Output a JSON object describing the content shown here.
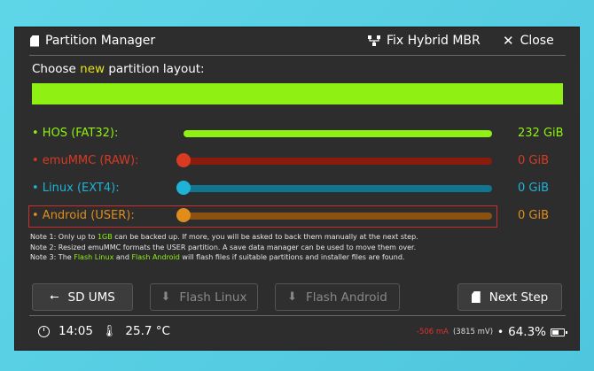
{
  "header": {
    "title": "Partition Manager",
    "fix_label": "Fix Hybrid MBR",
    "close_label": "Close"
  },
  "prompt": {
    "before": "Choose ",
    "highlight": "new",
    "after": " partition layout:"
  },
  "layout_bar": {
    "hos_fraction": 1.0
  },
  "partitions": [
    {
      "label": "• HOS (FAT32):",
      "value": "232 GiB",
      "color": "#8ef013",
      "track": "#8ef013",
      "fraction": 1.0
    },
    {
      "label": "• emuMMC (RAW):",
      "value": "0 GiB",
      "color": "#d83a22",
      "track": "#8a1c0d",
      "fraction": 0
    },
    {
      "label": "• Linux (EXT4):",
      "value": "0 GiB",
      "color": "#1eb3d6",
      "track": "#10768f",
      "fraction": 0
    },
    {
      "label": "• Android (USER):",
      "value": "0 GiB",
      "color": "#e08d1c",
      "track": "#8a5110",
      "fraction": 0
    }
  ],
  "notes": {
    "n1_a": "Note 1: Only up to ",
    "n1_b": "1GB",
    "n1_c": " can be backed up. If more, you will be asked to back them manually at the next step.",
    "n2": "Note 2: Resized emuMMC formats the USER partition. A save data manager can be used to move them over.",
    "n3_a": "Note 3: The ",
    "n3_b": "Flash Linux",
    "n3_c": " and ",
    "n3_d": "Flash Android",
    "n3_e": " will flash files if suitable partitions and installer files are found."
  },
  "buttons": {
    "sd_ums": "SD UMS",
    "flash_linux": "Flash Linux",
    "flash_android": "Flash Android",
    "next_step": "Next Step"
  },
  "status": {
    "time": "14:05",
    "temp": "25.7 °C",
    "current": "-506 mA",
    "voltage": "(3815 mV)",
    "battery_pct": "64.3%",
    "battery_level": 0.643
  }
}
